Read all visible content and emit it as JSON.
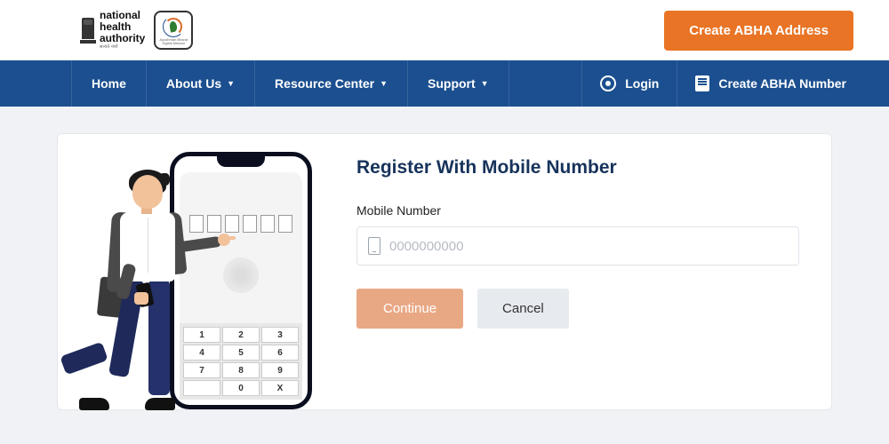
{
  "header": {
    "logo_text": {
      "line1": "national",
      "line2": "health",
      "line3": "authority",
      "sub": "सत्यते नारो"
    },
    "abdm_caption": "Ayushman Bharat Digital Mission",
    "cta_label": "Create ABHA Address"
  },
  "nav": {
    "items": [
      {
        "label": "Home",
        "has_dropdown": false
      },
      {
        "label": "About Us",
        "has_dropdown": true
      },
      {
        "label": "Resource Center",
        "has_dropdown": true
      },
      {
        "label": "Support",
        "has_dropdown": true
      }
    ],
    "login_label": "Login",
    "create_number_label": "Create ABHA Number"
  },
  "form": {
    "title": "Register With Mobile Number",
    "field_label": "Mobile Number",
    "placeholder": "0000000000",
    "value": "",
    "continue_label": "Continue",
    "cancel_label": "Cancel"
  },
  "keypad": [
    "1",
    "2",
    "3",
    "4",
    "5",
    "6",
    "7",
    "8",
    "9",
    "",
    "0",
    "X"
  ]
}
